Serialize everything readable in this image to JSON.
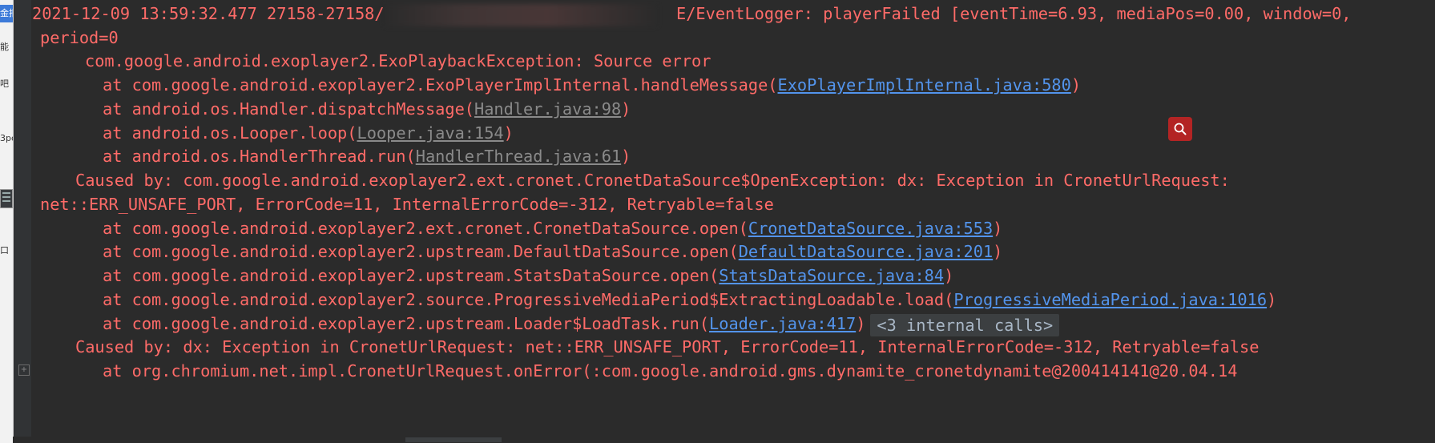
{
  "left_strip": {
    "fragments": [
      "金报",
      "能",
      "吧",
      "3pc",
      "口"
    ]
  },
  "log": {
    "lines": [
      {
        "pre": "2021-12-09 13:59:32.477 27158-27158/",
        "redacted": true,
        "post": "  E/EventLogger: playerFailed [eventTime=6.93, mediaPos=0.00, window=0,"
      },
      {
        "text": "period=0"
      },
      {
        "text": "com.google.android.exoplayer2.ExoPlaybackException: Source error"
      },
      {
        "pre": "at com.google.android.exoplayer2.ExoPlayerImplInternal.handleMessage(",
        "link": "ExoPlayerImplInternal.java:580",
        "post": ")"
      },
      {
        "pre": "at android.os.Handler.dispatchMessage(",
        "link": "Handler.java:98",
        "post": ")"
      },
      {
        "pre": "at android.os.Looper.loop(",
        "link": "Looper.java:154",
        "post": ")"
      },
      {
        "pre": "at android.os.HandlerThread.run(",
        "link": "HandlerThread.java:61",
        "post": ")"
      },
      {
        "text": "Caused by: com.google.android.exoplayer2.ext.cronet.CronetDataSource$OpenException: dx: Exception in CronetUrlRequest:"
      },
      {
        "text": "net::ERR_UNSAFE_PORT, ErrorCode=11, InternalErrorCode=-312, Retryable=false"
      },
      {
        "pre": "at com.google.android.exoplayer2.ext.cronet.CronetDataSource.open(",
        "link": "CronetDataSource.java:553",
        "post": ")"
      },
      {
        "pre": "at com.google.android.exoplayer2.upstream.DefaultDataSource.open(",
        "link": "DefaultDataSource.java:201",
        "post": ")"
      },
      {
        "pre": "at com.google.android.exoplayer2.upstream.StatsDataSource.open(",
        "link": "StatsDataSource.java:84",
        "post": ")"
      },
      {
        "pre": "at com.google.android.exoplayer2.source.ProgressiveMediaPeriod$ExtractingLoadable.load(",
        "link": "ProgressiveMediaPeriod.java:1016",
        "post": ")"
      },
      {
        "pre": "at com.google.android.exoplayer2.upstream.Loader$LoadTask.run(",
        "link": "Loader.java:417",
        "post": ")",
        "badge": "<3 internal calls>"
      },
      {
        "text": "Caused by: dx: Exception in CronetUrlRequest: net::ERR_UNSAFE_PORT, ErrorCode=11, InternalErrorCode=-312, Retryable=false"
      },
      {
        "text": "at org.chromium.net.impl.CronetUrlRequest.onError(:com.google.android.gms.dynamite_cronetdynamite@200414141@20.04.14"
      }
    ]
  },
  "fold_marker": "+",
  "colors": {
    "error_text": "#ff6b68",
    "link": "#5394ec",
    "background": "#2b2b2b",
    "search_button": "#b32424"
  },
  "icons": {
    "search": "magnifier-icon"
  }
}
